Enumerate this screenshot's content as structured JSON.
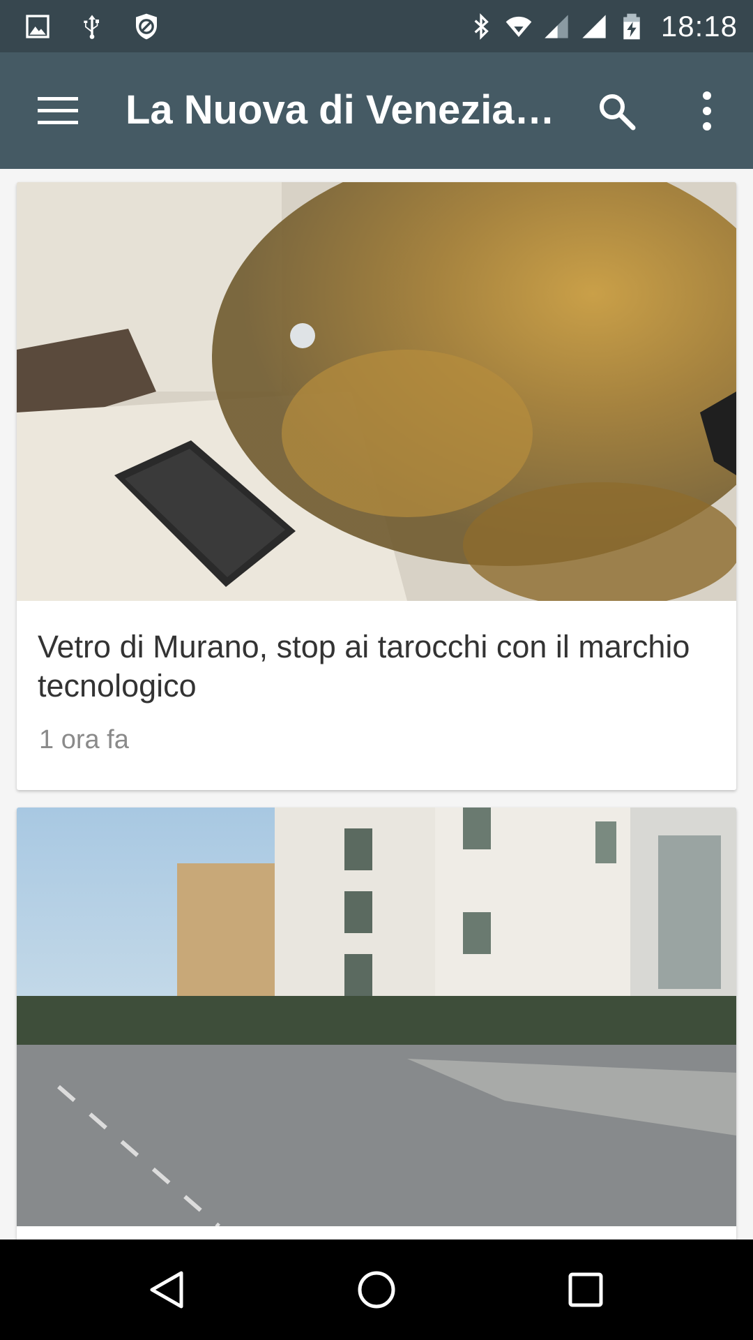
{
  "status_bar": {
    "time": "18:18",
    "left_icons": [
      "image-icon",
      "usb-icon",
      "blocked-icon"
    ],
    "right_icons": [
      "bluetooth-icon",
      "wifi-icon",
      "signal-icon",
      "battery-charging-icon"
    ]
  },
  "app_bar": {
    "title": "La Nuova di Venezia (…",
    "menu_icon": "hamburger-menu-icon",
    "search_icon": "search-icon",
    "overflow_icon": "more-vert-icon"
  },
  "feed": {
    "articles": [
      {
        "title": "Vetro di Murano, stop ai tarocchi con il marchio tecnologico",
        "time": "1 ora fa"
      }
    ]
  },
  "nav_bar": {
    "buttons": [
      "back-icon",
      "home-icon",
      "recents-icon"
    ]
  },
  "colors": {
    "status_bar": "#37474f",
    "app_bar": "#455a64",
    "background": "#f5f5f5",
    "card": "#ffffff",
    "title_text": "#333333",
    "meta_text": "#8a8a8a"
  }
}
